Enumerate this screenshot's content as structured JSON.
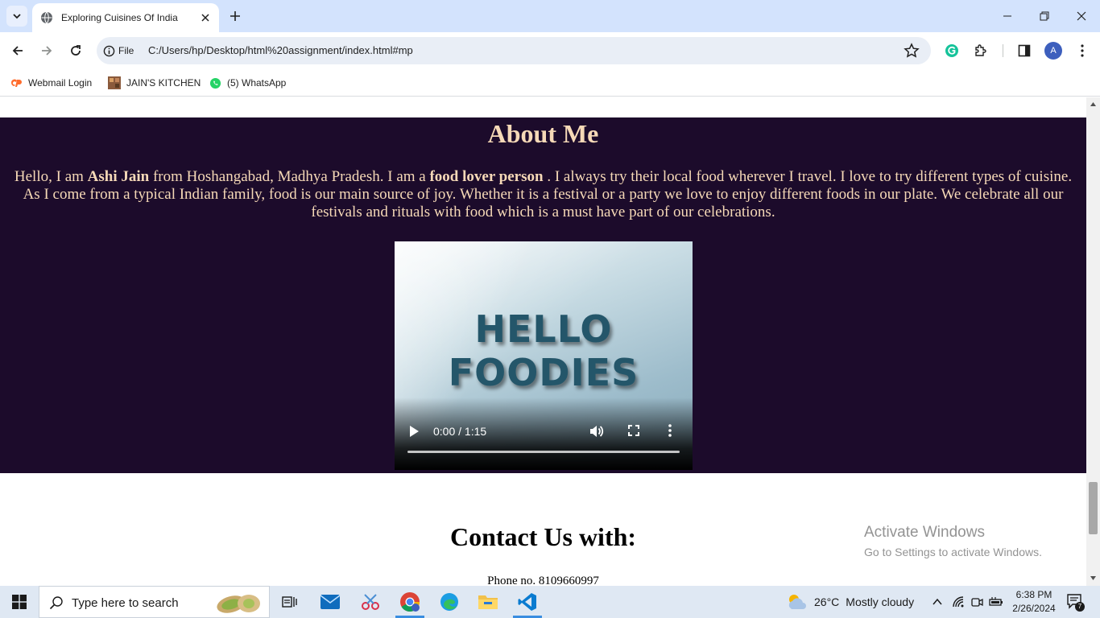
{
  "browser": {
    "tab_title": "Exploring Cuisines Of India",
    "omnibox_scheme": "File",
    "url": "C:/Users/hp/Desktop/html%20assignment/index.html#mp",
    "profile_initial": "A",
    "bookmarks": [
      {
        "label": "Webmail Login",
        "icon": "cpanel-icon"
      },
      {
        "label": "JAIN'S KITCHEN",
        "icon": "kitchen-favicon"
      },
      {
        "label": "(5) WhatsApp",
        "icon": "whatsapp-icon"
      }
    ]
  },
  "about": {
    "heading": "About Me",
    "p_hello": "Hello, I am ",
    "p_name": "Ashi Jain",
    "p_mid": " from Hoshangabad, Madhya Pradesh. I am a ",
    "p_bold": "food lover person",
    "p_rest": " . I always try their local food wherever I travel. I love to try different types of cuisine. As I come from a typical Indian family, food is our main source of joy. Whether it is a festival or a party we love to enjoy different foods in our plate. We celebrate all our festivals and rituals with food which is a must have part of our celebrations.",
    "video": {
      "poster_line1": "HELLO",
      "poster_line2": "FOODIES",
      "time": "0:00 / 1:15",
      "progress": 0
    }
  },
  "contact": {
    "heading": "Contact Us with:",
    "phone": "Phone no. 8109660997"
  },
  "watermark": {
    "line1": "Activate Windows",
    "line2": "Go to Settings to activate Windows."
  },
  "taskbar": {
    "search_placeholder": "Type here to search",
    "weather_temp": "26°C",
    "weather_desc": "Mostly cloudy",
    "time": "6:38 PM",
    "date": "2/26/2024",
    "notification_count": "7"
  },
  "colors": {
    "about_bg": "#1c0b2b",
    "about_text": "#f6d9b7",
    "tabstrip": "#d3e3fd"
  }
}
